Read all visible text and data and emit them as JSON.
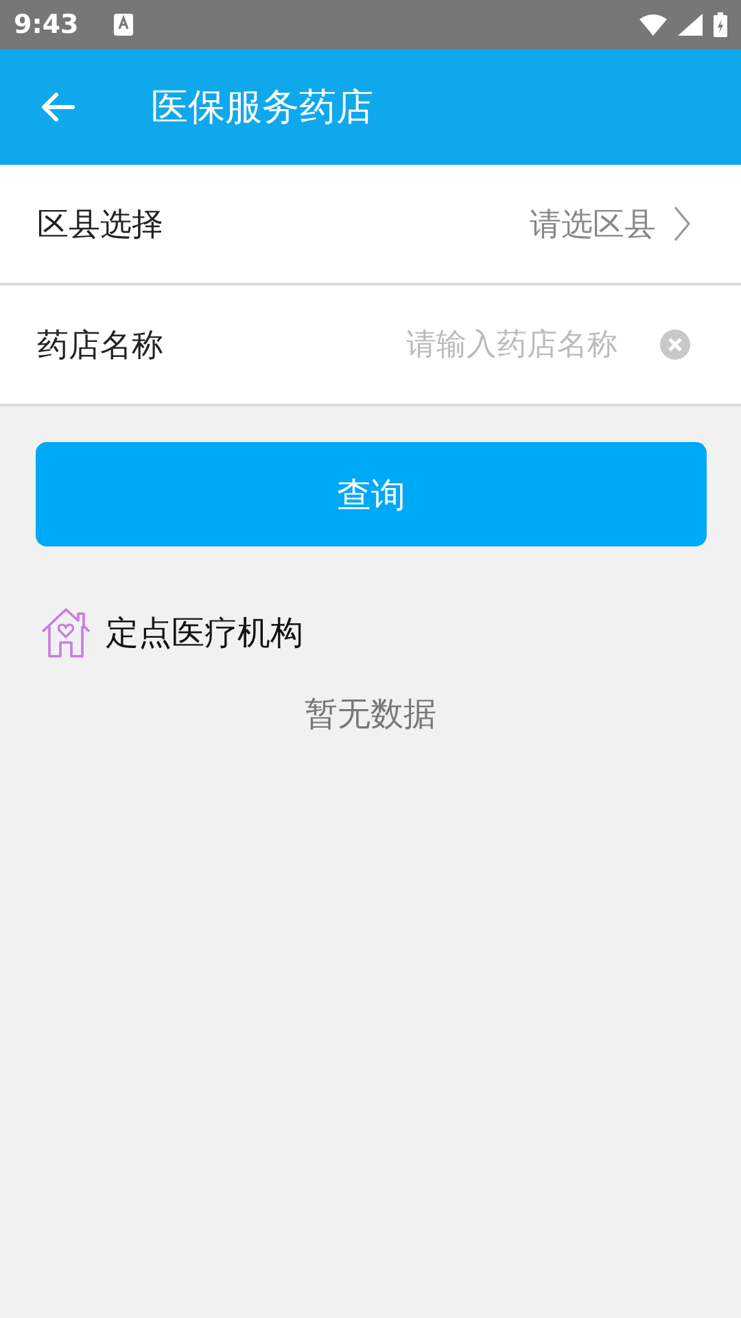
{
  "status_bar": {
    "time": "9:43"
  },
  "app_bar": {
    "title": "医保服务药店"
  },
  "district": {
    "label": "区县选择",
    "placeholder": "请选区县"
  },
  "pharmacy": {
    "label": "药店名称",
    "placeholder": "请输入药店名称"
  },
  "search_button": "查询",
  "section": {
    "title": "定点医疗机构",
    "empty_text": "暂无数据"
  }
}
